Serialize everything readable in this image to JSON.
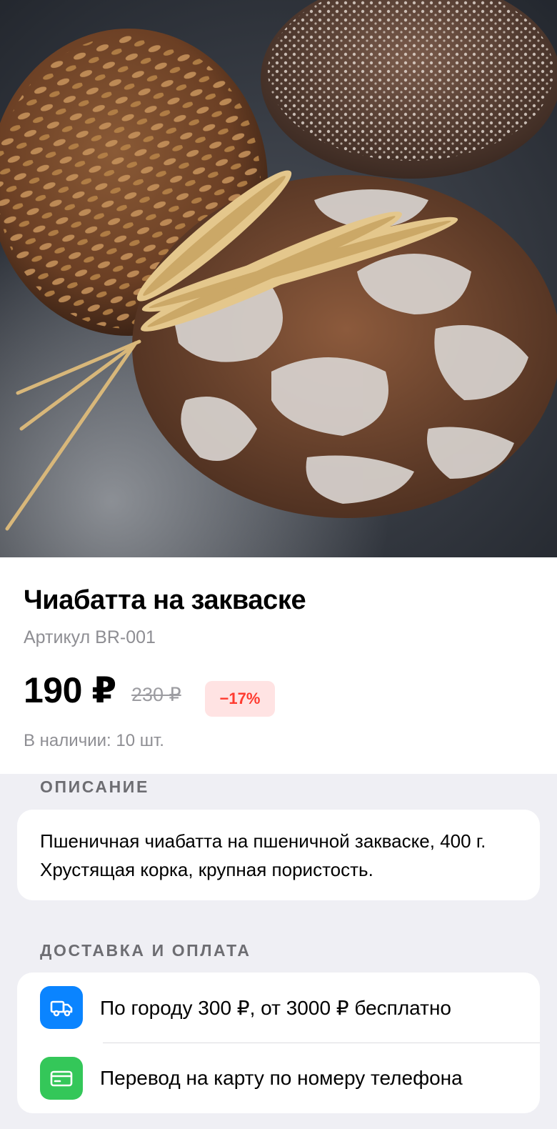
{
  "product": {
    "title": "Чиабатта на закваске",
    "sku": "Артикул BR-001",
    "price": "190 ₽",
    "old_price": "230 ₽",
    "discount": "−17%",
    "stock": "В наличии: 10 шт."
  },
  "description": {
    "header": "ОПИСАНИЕ",
    "text": "Пшеничная чиабатта на пшеничной закваске, 400 г. Хрустящая корка, крупная пористость."
  },
  "delivery": {
    "header": "ДОСТАВКА И ОПЛАТА",
    "rows": [
      {
        "label": "По городу 300 ₽, от 3000 ₽ бесплатно",
        "icon": "truck-icon",
        "color": "#0a84ff"
      },
      {
        "label": "Перевод на карту по номеру телефона",
        "icon": "card-icon",
        "color": "#34c759"
      }
    ]
  },
  "colors": {
    "discount_badge_bg": "#ffe3e3",
    "discount_text": "#ff3b30",
    "secondary_text": "#8e8e93",
    "grouped_background": "#efeff4"
  }
}
